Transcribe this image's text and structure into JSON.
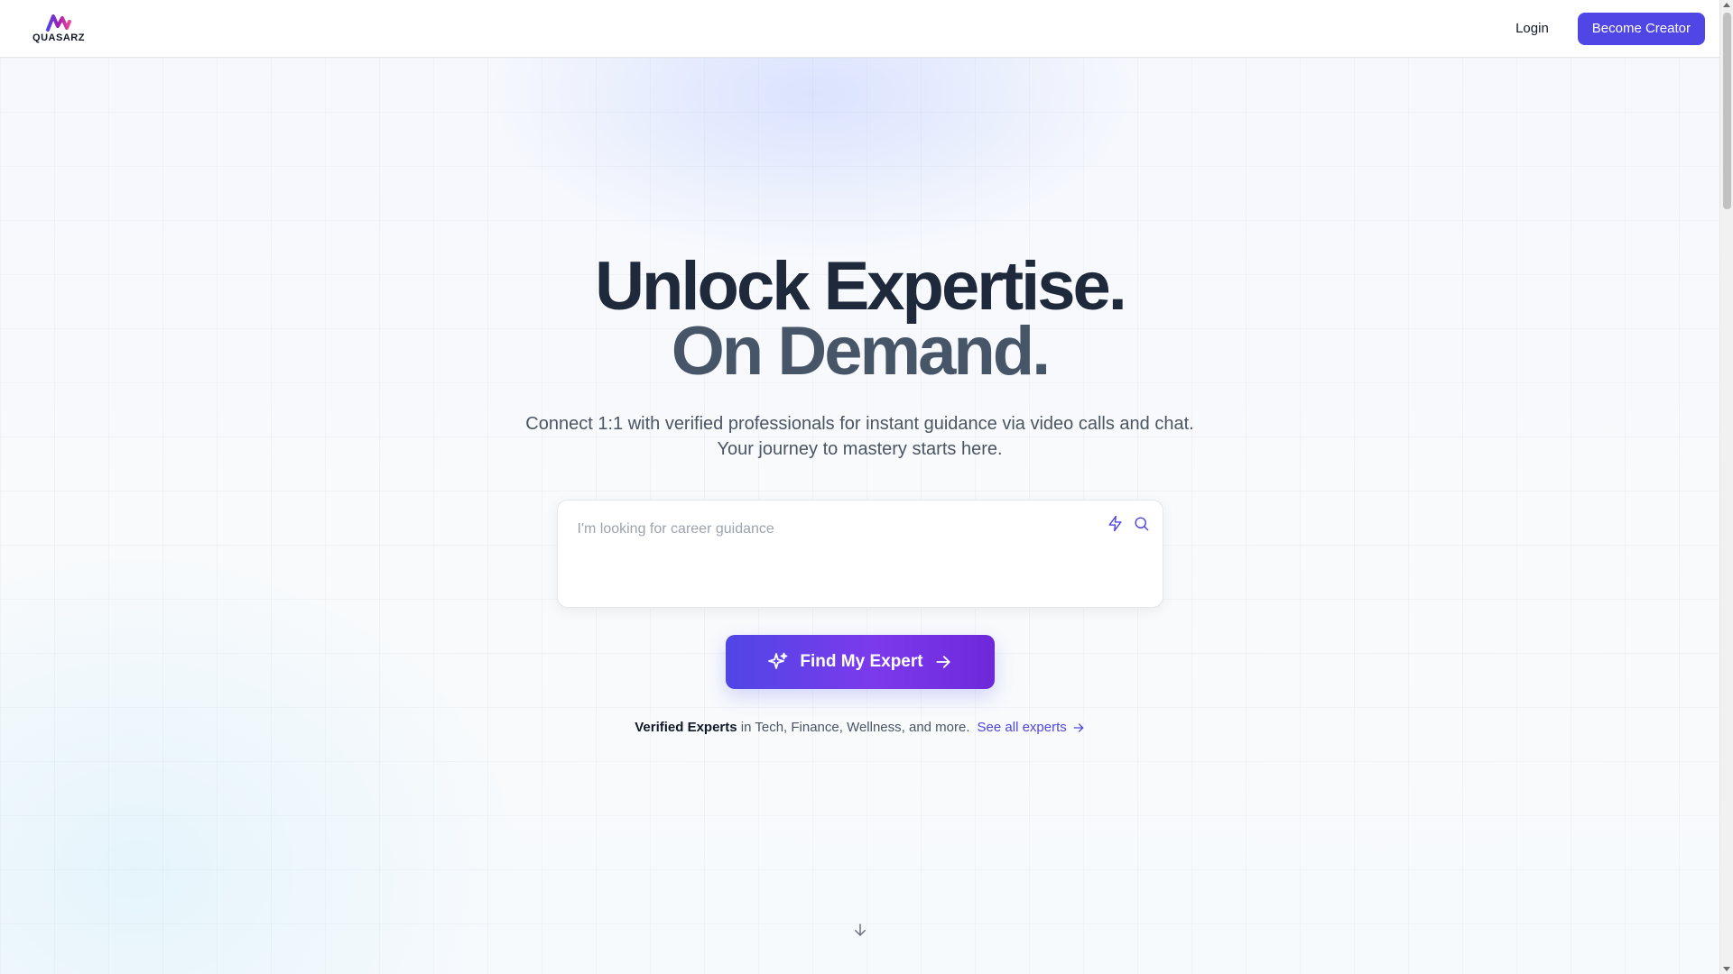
{
  "header": {
    "logo_text": "QUASARZ",
    "login_label": "Login",
    "become_creator_label": "Become Creator"
  },
  "hero": {
    "title_line_1": "Unlock Expertise.",
    "title_line_2": "On Demand.",
    "subtitle": "Connect 1:1 with verified professionals for instant guidance via video calls and chat. Your journey to mastery starts here.",
    "search": {
      "placeholder": "I'm looking for career guidance",
      "value": ""
    },
    "find_button_label": "Find My Expert",
    "verified_strong": "Verified Experts",
    "verified_rest": "in Tech, Finance, Wellness, and more.",
    "see_all_label": "See all experts"
  },
  "icons": {
    "logo": "quasarz-logo-icon",
    "bolt": "bolt-icon",
    "search": "search-icon",
    "sparkles": "sparkles-icon",
    "arrow_right": "arrow-right-icon",
    "arrow_down": "arrow-down-icon"
  },
  "colors": {
    "accent": "#4f46e5",
    "accent_purple": "#7c3aed",
    "title_dark": "#1e293b",
    "title_slate": "#475569"
  }
}
